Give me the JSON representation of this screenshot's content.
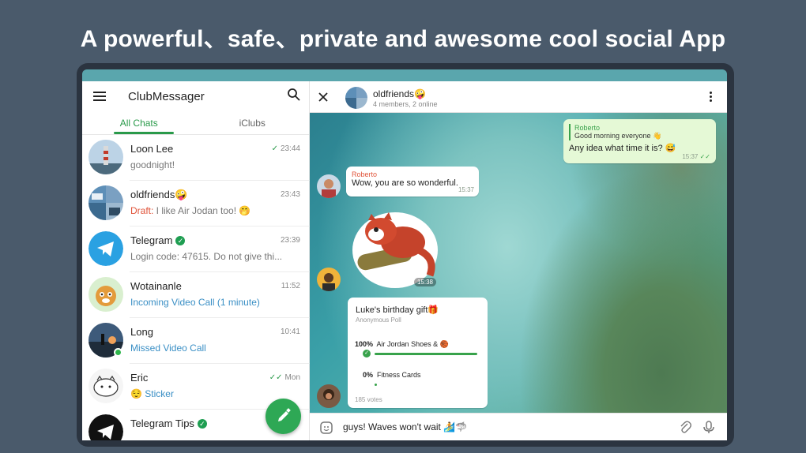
{
  "headline": "A powerful、safe、private and awesome cool social App",
  "app": {
    "title": "ClubMessager"
  },
  "tabs": [
    {
      "label": "All Chats"
    },
    {
      "label": "iClubs"
    }
  ],
  "chats": [
    {
      "name": "Loon Lee",
      "time": "23:44",
      "preview": "goodnight!"
    },
    {
      "name": "oldfriends🤪",
      "time": "23:43",
      "draft_label": "Draft:",
      "preview": " I like Air Jodan  too! 🤭"
    },
    {
      "name": "Telegram",
      "time": "23:39",
      "preview": "Login code: 47615. Do not give thi..."
    },
    {
      "name": "Wotainanle",
      "time": "11:52",
      "preview": "Incoming Video Call (1 minute)"
    },
    {
      "name": "Long",
      "time": "10:41",
      "preview": "Missed Video Call"
    },
    {
      "name": "Eric",
      "time": "Mon",
      "preview": "😌 Sticker"
    },
    {
      "name": "Telegram Tips",
      "time": "",
      "preview": ""
    }
  ],
  "chat": {
    "group_name": "oldfriends🤪",
    "group_sub": "4 members, 2 online",
    "messages": {
      "out1": {
        "reply_name": "Roberto",
        "reply_text": "Good morning everyone 👋",
        "text": "Any idea what time it is? 😅",
        "time": "15:37"
      },
      "in1": {
        "sender": "Roberto",
        "text": "Wow, you are so wonderful.",
        "time": "15:37"
      },
      "sticker": {
        "time": "15:38"
      },
      "poll": {
        "title": "Luke's birthday gift🎁",
        "type": "Anonymous Poll",
        "options": [
          {
            "pct": "100%",
            "label": "Air Jordan Shoes & 🏀",
            "share": 1.0
          },
          {
            "pct": "0%",
            "label": "Fitness Cards",
            "share": 0.0
          }
        ],
        "votes": "185 votes"
      }
    },
    "composer_text": "guys! Waves won't wait 🏄🦈"
  },
  "colors": {
    "accent": "#2a9a4a",
    "background": "#4a5a6b",
    "draft": "#e0553b",
    "link": "#3a8fc5"
  }
}
